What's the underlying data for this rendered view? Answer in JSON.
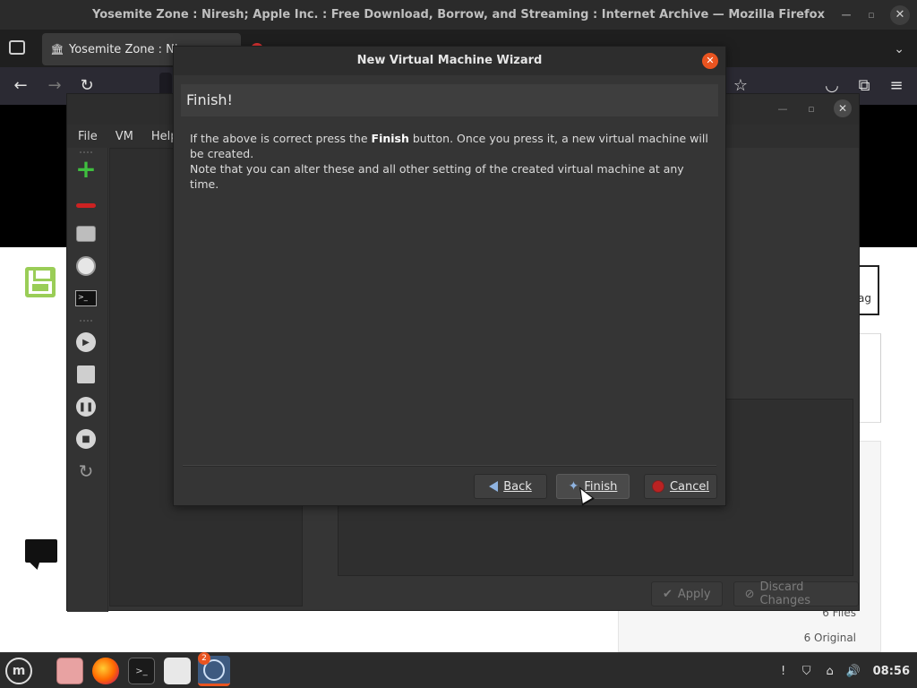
{
  "firefox": {
    "window_title": "Yosemite Zone : Niresh; Apple Inc. : Free Download, Borrow, and Streaming : Internet Archive — Mozilla Firefox",
    "active_tab_label": "Yosemite Zone : Nir",
    "second_tab_label": ""
  },
  "page": {
    "flag_label": "ag",
    "files_count": "6 Files",
    "original_count": "6 Original"
  },
  "qemu": {
    "menu": [
      "File",
      "VM",
      "Help"
    ],
    "apply_label": "Apply",
    "discard_label": "Discard Changes"
  },
  "wizard": {
    "title": "New Virtual Machine Wizard",
    "header": "Finish!",
    "body_pre": "If the above is correct press the ",
    "body_bold": "Finish",
    "body_post": " button. Once you press it, a new virtual machine will be created.",
    "body_line2": "Note that you can alter these and all other setting of the created virtual machine at any time.",
    "back_label": "Back",
    "finish_label": "Finish",
    "cancel_label": "Cancel"
  },
  "taskbar": {
    "notification_count": "2",
    "clock": "08:56"
  },
  "colors": {
    "accent": "#e95420",
    "dialog_bg": "#353535",
    "titlebar_bg": "#2d2d2d"
  }
}
